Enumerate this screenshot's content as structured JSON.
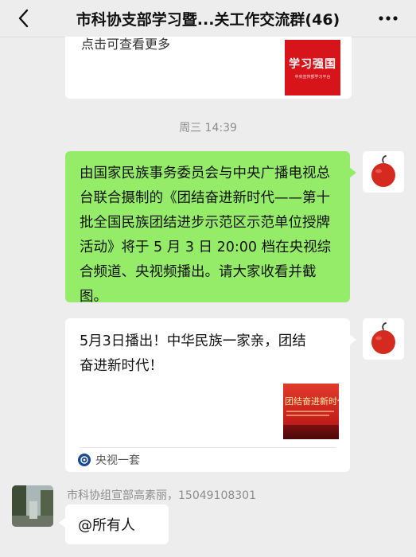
{
  "header": {
    "title": "市科协支部学习暨...关工作交流群(46)",
    "back_icon": "chevron-left-icon",
    "more_icon": "more-dots-icon"
  },
  "top_card": {
    "text": "点击可查看更多",
    "thumbnail": {
      "logo_text": "学习强国",
      "sub_text": "中央宣传部学习平台"
    }
  },
  "timestamp": "周三 14:39",
  "messages": [
    {
      "type": "text",
      "side": "right",
      "text": "由国家民族事务委员会与中央广播电视总台联合摄制的《团结奋进新时代——第十批全国民族团结进步示范区示范单位授牌活动》将于 5 月 3 日 20:00 档在央视综合频道、央视频播出。请大家收看并截图。",
      "bubble_color": "#95ec69"
    },
    {
      "type": "video-card",
      "side": "right",
      "text": "5月3日播出！中华民族一家亲，团结奋进新时代！",
      "thumbnail": {
        "title": "团结奋进新时代"
      },
      "source": "央视一套"
    },
    {
      "type": "text",
      "side": "left",
      "sender": "市科协组宣部高素丽，15049108301",
      "text": "@所有人"
    }
  ],
  "colors": {
    "background": "#ededed",
    "green_bubble": "#95ec69",
    "timestamp_gray": "#8d8d8d",
    "xuexi_red": "#d6141a"
  }
}
